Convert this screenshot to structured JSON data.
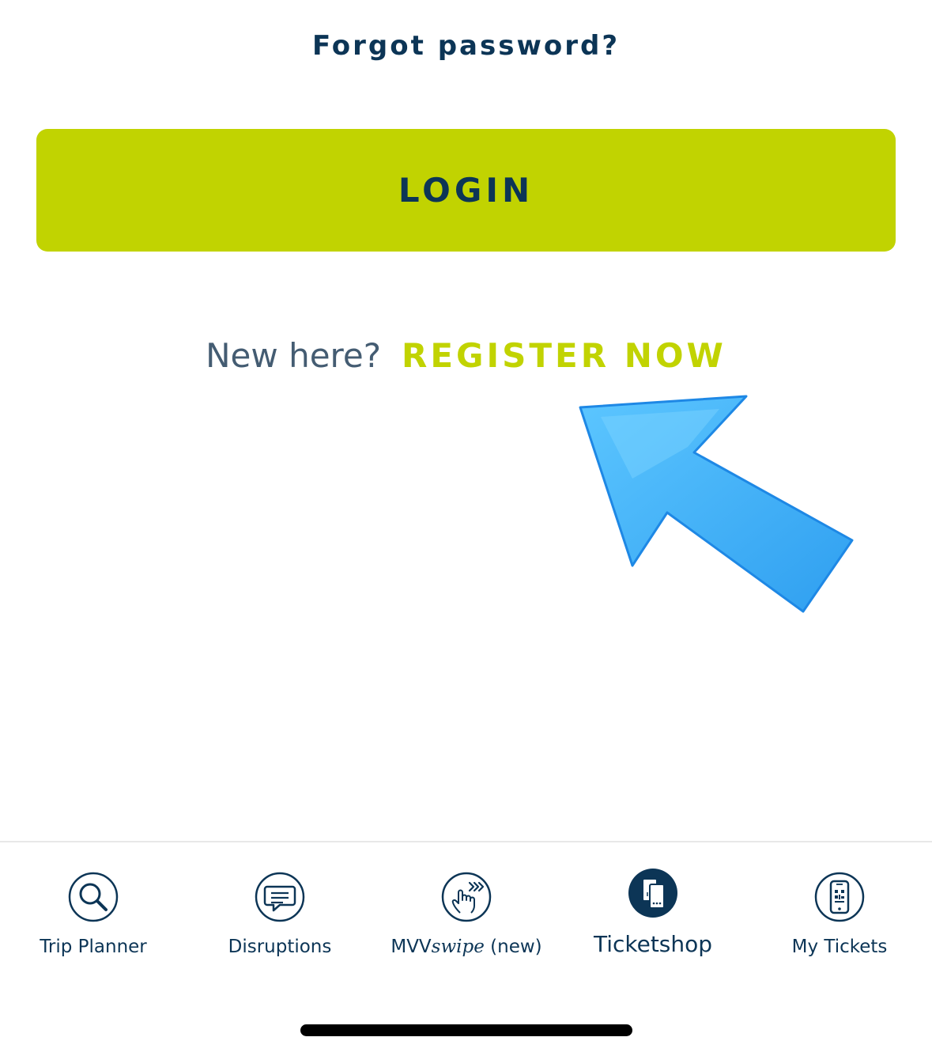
{
  "auth": {
    "forgot_password": "Forgot password?",
    "login_label": "LOGIN",
    "new_here": "New here?",
    "register_now": "REGISTER NOW"
  },
  "tabbar": {
    "items": [
      {
        "label": "Trip Planner",
        "icon": "magnifier-icon",
        "active": false
      },
      {
        "label": "Disruptions",
        "icon": "speech-bubble-icon",
        "active": false
      },
      {
        "label_prefix": "MVV",
        "label_italic": "swipe",
        "label_suffix": " (new)",
        "icon": "swipe-hand-icon",
        "active": false
      },
      {
        "label": "Ticketshop",
        "icon": "ticketshop-icon",
        "active": true
      },
      {
        "label": "My Tickets",
        "icon": "phone-ticket-icon",
        "active": false
      }
    ]
  },
  "colors": {
    "brand_lime": "#c1d301",
    "brand_navy": "#0c3556",
    "annotation_arrow": "#3ab0f5"
  }
}
